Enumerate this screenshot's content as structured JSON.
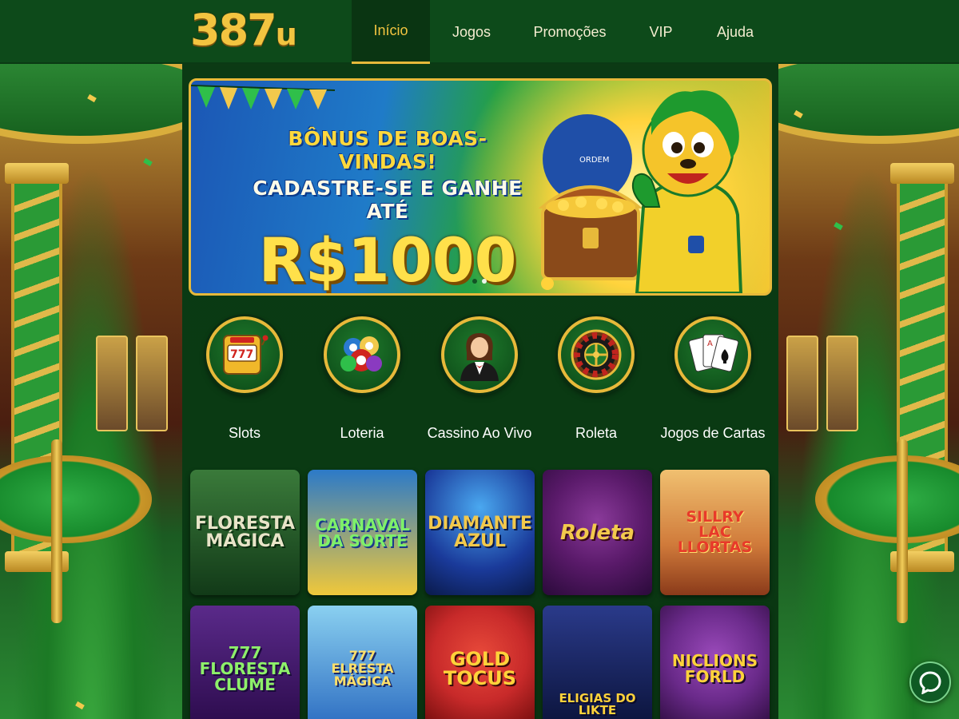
{
  "brand": {
    "logo_main": "387",
    "logo_suffix": "u"
  },
  "nav": {
    "items": [
      {
        "label": "Início",
        "active": true
      },
      {
        "label": "Jogos",
        "active": false
      },
      {
        "label": "Promoções",
        "active": false
      },
      {
        "label": "VIP",
        "active": false
      },
      {
        "label": "Ajuda",
        "active": false
      }
    ]
  },
  "banner": {
    "line1": "BÔNUS DE BOAS-VINDAS!",
    "line2": "CADASTRE-SE E GANHE ATÉ",
    "amount": "R$1000",
    "mascot_shirt_text": "ORDEM",
    "slide_index": 1,
    "slide_count": 2
  },
  "categories": [
    {
      "label": "Slots",
      "icon": "slot-machine-icon"
    },
    {
      "label": "Loteria",
      "icon": "lottery-balls-icon"
    },
    {
      "label": "Cassino Ao Vivo",
      "icon": "live-dealer-icon"
    },
    {
      "label": "Roleta",
      "icon": "roulette-wheel-icon"
    },
    {
      "label": "Jogos de Cartas",
      "icon": "playing-cards-icon"
    }
  ],
  "games": [
    {
      "title": "FLORESTA\nMÁGICA",
      "bg": "#1f5a2a",
      "bg2": "#0f3314",
      "fg": "#e8e4c8"
    },
    {
      "title": "CARNAVAL\nDA SORTE",
      "bg": "#2c7ac8",
      "bg2": "#f0c83a",
      "fg": "#7ef06a"
    },
    {
      "title": "DIAMANTE\nAZUL",
      "bg": "#1a3a9a",
      "bg2": "#0a1a4a",
      "fg": "#f2c94c"
    },
    {
      "title": "Roleta",
      "bg": "#5a1a6a",
      "bg2": "#2a0a3a",
      "fg": "#f2c94c"
    },
    {
      "title": "SILLRY\nLAC LLORTAS",
      "bg": "#e8a04a",
      "bg2": "#b24a2a",
      "fg": "#e83a2a"
    },
    {
      "title": "777\nFLORESTA\nCLUME",
      "bg": "#4a1a7a",
      "bg2": "#2a0a4a",
      "fg": "#8ef06a"
    },
    {
      "title": "777\nELRESTA MÁGICA",
      "bg": "#4aa8e0",
      "bg2": "#2a6ac0",
      "fg": "#ffe06a"
    },
    {
      "title": "GOLD\nTOCUS",
      "bg": "#c82a2a",
      "bg2": "#6a0a0a",
      "fg": "#ffd23a"
    },
    {
      "title": "ELIGIAS DO LIKTE",
      "bg": "#1a2a6a",
      "bg2": "#0a1238",
      "fg": "#ffd23a"
    },
    {
      "title": "NICLIONS\nFORLD",
      "bg": "#6a2a8a",
      "bg2": "#2a0a3a",
      "fg": "#ffd23a"
    }
  ],
  "chat": {
    "icon": "chat-bubble-icon"
  },
  "colors": {
    "gold": "#e7b93a",
    "header_green": "#0d4a1a",
    "panel_green": "#0b3a14"
  }
}
